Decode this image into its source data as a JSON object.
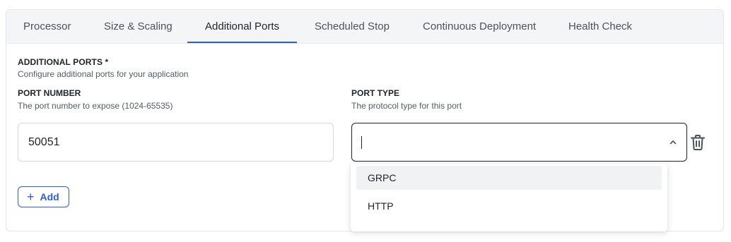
{
  "tabs": [
    {
      "label": "Processor",
      "active": false
    },
    {
      "label": "Size & Scaling",
      "active": false
    },
    {
      "label": "Additional Ports",
      "active": true
    },
    {
      "label": "Scheduled Stop",
      "active": false
    },
    {
      "label": "Continuous Deployment",
      "active": false
    },
    {
      "label": "Health Check",
      "active": false
    }
  ],
  "section": {
    "title": "ADDITIONAL PORTS *",
    "description": "Configure additional ports for your application"
  },
  "port_number": {
    "label": "PORT NUMBER",
    "description": "The port number to expose (1024-65535)",
    "value": "50051"
  },
  "port_type": {
    "label": "PORT TYPE",
    "description": "The protocol type for this port",
    "value": "",
    "options": [
      "GRPC",
      "HTTP"
    ],
    "highlighted_option": "GRPC"
  },
  "add_button": {
    "label": "Add",
    "icon": "plus-icon"
  },
  "icons": {
    "delete": "trash-icon",
    "select": "chevron-up-icon"
  },
  "colors": {
    "accent": "#2f5fc4",
    "tab_bar": "#f4f5f7"
  }
}
